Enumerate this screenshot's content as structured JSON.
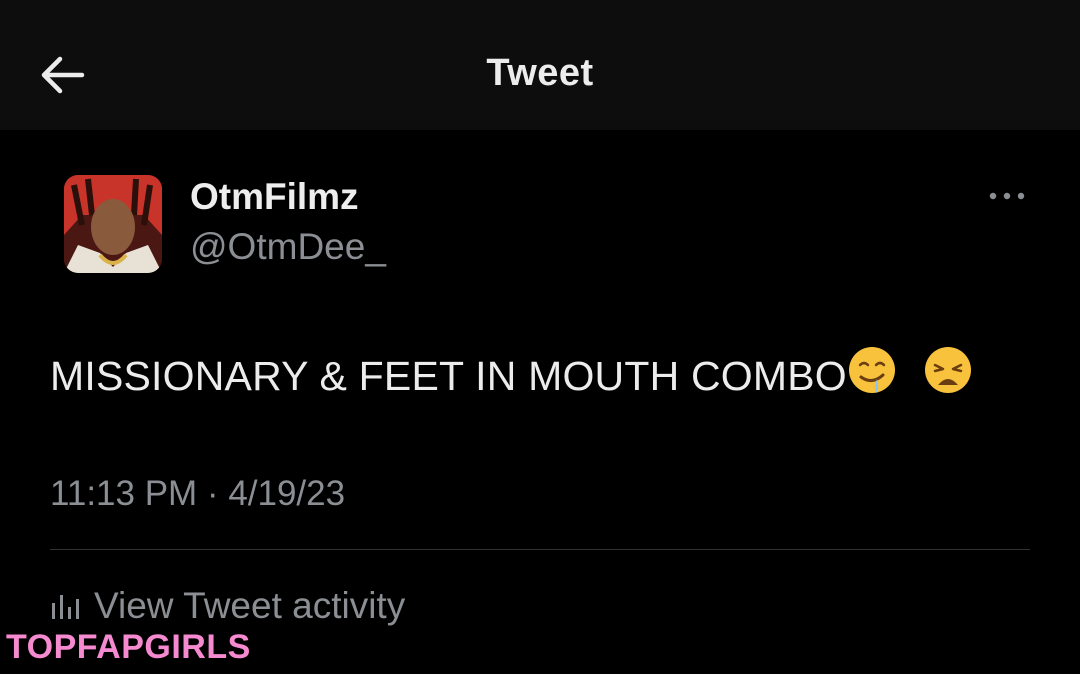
{
  "header": {
    "title": "Tweet",
    "back_icon": "arrow-left-icon"
  },
  "tweet": {
    "display_name": "OtmFilmz",
    "handle": "@OtmDee_",
    "text": "MISSIONARY & FEET IN MOUTH COMBO",
    "emojis": [
      "drooling-face-emoji",
      "weary-face-emoji"
    ],
    "timestamp": "11:13 PM · 4/19/23",
    "more_icon": "more-horizontal-icon"
  },
  "actions": {
    "view_activity_label": "View Tweet activity",
    "activity_icon": "bar-chart-icon"
  },
  "watermark": "TOPFAPGIRLS",
  "colors": {
    "background": "#000000",
    "header_background": "#0d0d0d",
    "primary_text": "#e7e9ea",
    "secondary_text": "#8b8f94",
    "divider": "#2f3336",
    "watermark": "#f68ad0"
  }
}
